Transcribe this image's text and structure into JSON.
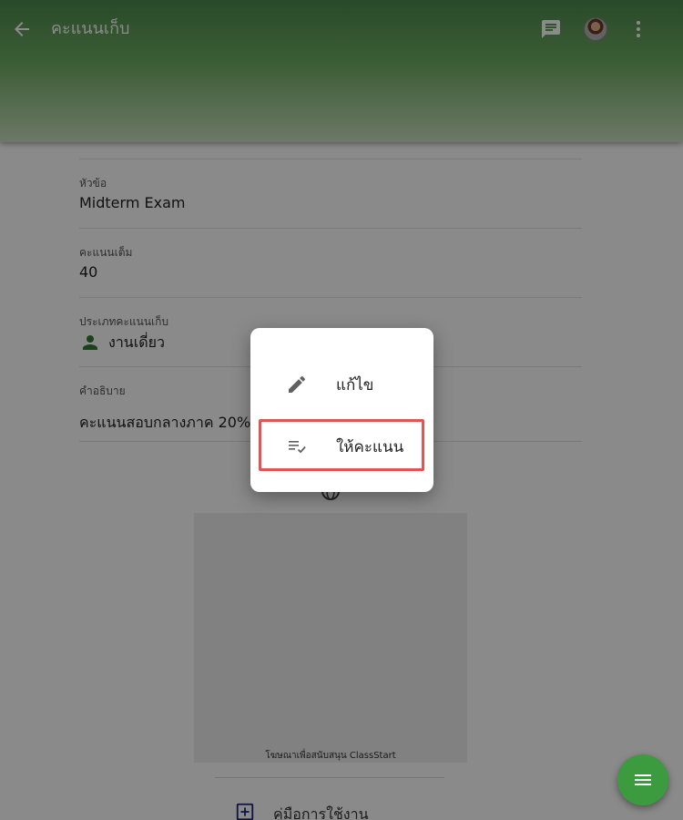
{
  "header": {
    "title": "คะแนนเก็บ",
    "back_icon": "arrow-back-icon",
    "chat_icon": "chat-icon",
    "more_icon": "more-vert-icon"
  },
  "fields": {
    "topic": {
      "label": "หัวข้อ",
      "value": "Midterm Exam"
    },
    "full_score": {
      "label": "คะแนนเต็ม",
      "value": "40"
    },
    "type": {
      "label": "ประเภทคะแนนเก็บ",
      "value": "งานเดี่ยว",
      "icon": "person-icon"
    },
    "description": {
      "label": "คำอธิบาย",
      "value": "คะแนนสอบกลางภาค 20%"
    }
  },
  "ad": {
    "caption": "โฆษณาเพื่อสนับสนุน ClassStart",
    "icon": "globe-icon"
  },
  "manual": {
    "label": "คู่มือการใช้งาน",
    "icon": "add-box-icon"
  },
  "dialog": {
    "items": [
      {
        "label": "แก้ไข",
        "icon": "edit-pencil-icon"
      },
      {
        "label": "ให้คะแนน",
        "icon": "playlist-check-icon",
        "highlighted": true
      }
    ]
  },
  "fab": {
    "icon": "menu-icon"
  },
  "colors": {
    "header_green": "#4e8a4c",
    "fab_green": "#3d9b3f",
    "highlight_red": "#e05656",
    "person_icon_green": "#2e7d32"
  }
}
